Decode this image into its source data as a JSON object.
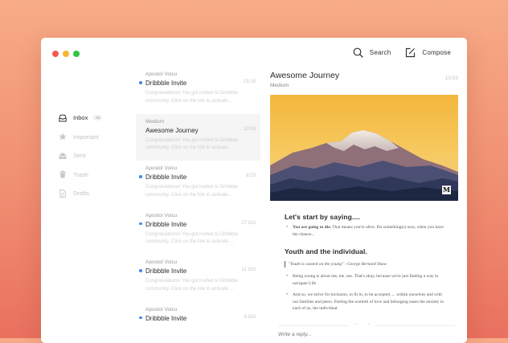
{
  "toolbar": {
    "search_label": "Search",
    "compose_label": "Compose"
  },
  "sidebar": {
    "items": [
      {
        "label": "Inbox",
        "badge": "44",
        "icon": "inbox-icon",
        "active": true
      },
      {
        "label": "Important",
        "icon": "star-icon"
      },
      {
        "label": "Sent",
        "icon": "envelope-icon"
      },
      {
        "label": "Trash",
        "icon": "trash-icon"
      },
      {
        "label": "Drafts",
        "icon": "document-icon"
      }
    ]
  },
  "messages": [
    {
      "from": "Apostol Voicu",
      "subject": "Dribbble Invite",
      "time": "15:19",
      "preview": "Congratulations! You got invited to Dribbble community. Click on the link to activate ...",
      "unread": true
    },
    {
      "from": "Medium",
      "subject": "Awesome Journey",
      "time": "10:03",
      "preview": "Congratulations! You got invited to Dribbble community. Click on the link to activate ...",
      "unread": false
    },
    {
      "from": "Apostol Voicu",
      "subject": "Dribbble Invite",
      "time": "8:23",
      "preview": "Congratulations! You got invited to Dribbble community. Click on the link to activate ...",
      "unread": true
    },
    {
      "from": "Apostol Voicu",
      "subject": "Dribbble Invite",
      "time": "27 Oct",
      "preview": "Congratulations! You got invited to Dribbble community. Click on the link to activate ...",
      "unread": true
    },
    {
      "from": "Apostol Voicu",
      "subject": "Dribbble Invite",
      "time": "11 Oct",
      "preview": "Congratulations! You got invited to Dribbble community. Click on the link to activate ...",
      "unread": true
    },
    {
      "from": "Apostol Voicu",
      "subject": "Dribbble Invite",
      "time": "6 Oct",
      "preview": "",
      "unread": true
    }
  ],
  "reader": {
    "title": "Awesome Journey",
    "source": "Medium",
    "time": "10:03",
    "logo_letter": "M",
    "heading1": "Let's start by saying....",
    "p1_bold": "You are going to die.",
    "p1_rest": " That means you're alive. Do something(s) now, when you have the chance...",
    "heading2": "Youth and the individual.",
    "quote": "\"Youth is wasted on the young\" - George Bernard Shaw",
    "p2": "Being young is about me, me ,me. That's okay, because we're just finding a way to navigate Life",
    "p3": "And so, we strive for inclusion, to fit in, to be accepted .... within ourselves and with our families and peers. Feeling the warmth of love and belonging eases the anxiety in each of us, the individual.",
    "prev_arrow": "←",
    "next_arrow": "→",
    "reply_placeholder": "Write a reply..."
  },
  "colors": {
    "accent": "#3d8bf2",
    "traffic_red": "#f15b52",
    "traffic_yellow": "#f6b52f",
    "traffic_green": "#33c448"
  }
}
